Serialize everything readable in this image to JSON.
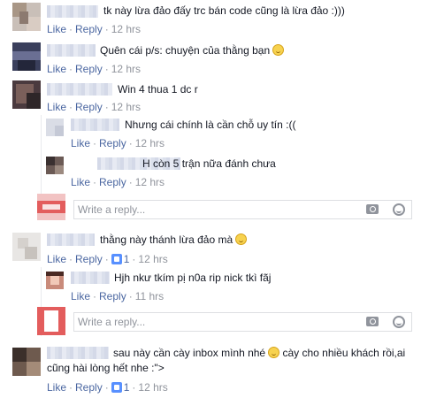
{
  "actions": {
    "like": "Like",
    "reply": "Reply",
    "sep": "·"
  },
  "comments": [
    {
      "text": "tk này lừa đảo đấy trc bán code cũng là lừa đảo :)))",
      "time": "12 hrs"
    },
    {
      "text": "Quên cái p/s: chuyện của thằng bạn",
      "emoji": "tongue-emoji",
      "time": "12 hrs"
    },
    {
      "text": "Win 4 thua 1 dc r",
      "time": "12 hrs",
      "replies": [
        {
          "text": "Nhưng cái chính là cần chỗ uy tín :((",
          "time": "12 hrs"
        },
        {
          "text": "H còn 5 trận nữa đánh chưa",
          "time": "12 hrs"
        }
      ]
    },
    {
      "text": "thằng này thánh lừa đảo mà",
      "emoji": "tongue-emoji",
      "likes": "1",
      "time": "12 hrs",
      "replies": [
        {
          "text": "Hjh nkư tkím pị n0a rip nick tkì fãj",
          "time": "11 hrs"
        }
      ]
    },
    {
      "text_line1": "sau này cần cày inbox mình nhé",
      "text_line1b": "cày cho nhiều khách rồi,ai",
      "text_line2": "cũng hài lòng hết nhe :\">",
      "emoji": "smile-emoji",
      "likes": "1",
      "time": "12 hrs"
    }
  ],
  "reply_box": {
    "placeholder": "Write a reply..."
  },
  "colors": {
    "link": "#4b67a1",
    "meta": "#90949c",
    "text": "#141823",
    "like_badge": "#5890ff"
  }
}
